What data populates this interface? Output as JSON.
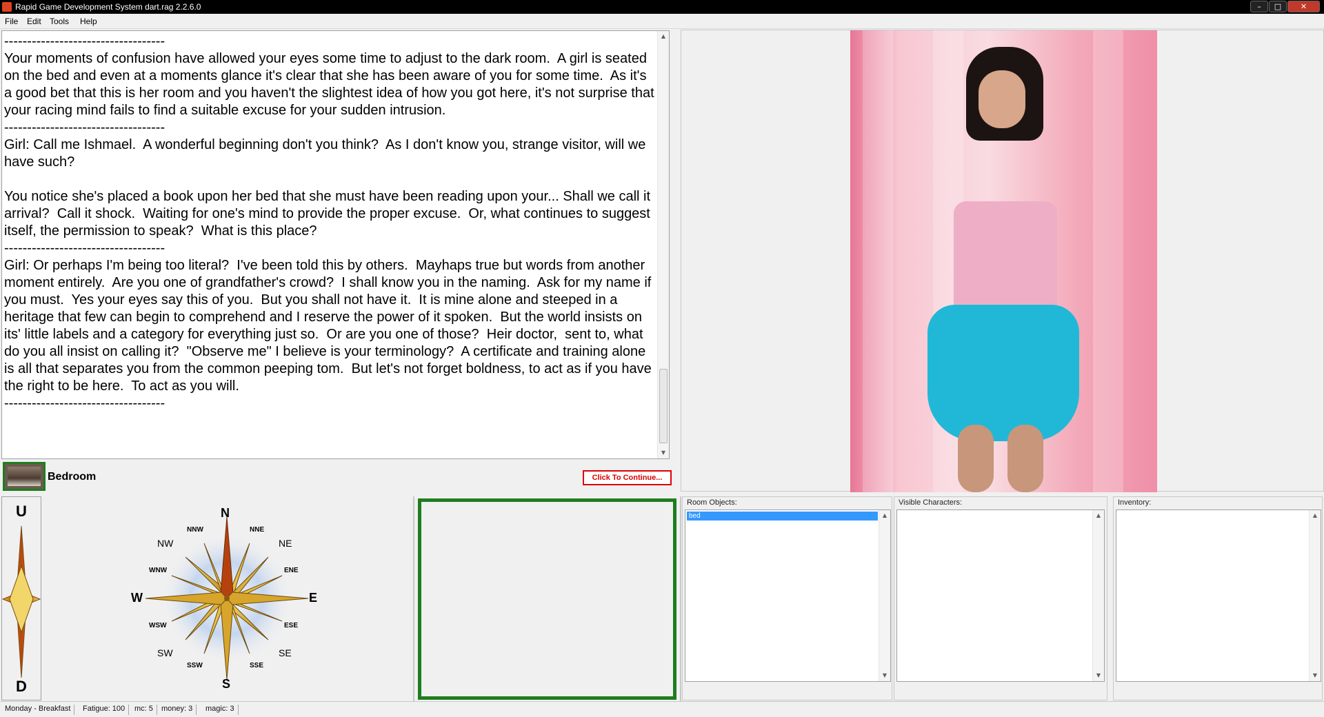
{
  "window": {
    "title": "Rapid Game Development System dart.rag 2.2.6.0",
    "min_label": "–",
    "max_label": "□",
    "close_label": "✕"
  },
  "menu": {
    "file": "File",
    "edit": "Edit",
    "tools": "Tools",
    "help": "Help"
  },
  "story": {
    "text": "-----------------------------------\nYour moments of confusion have allowed your eyes some time to adjust to the dark room.  A girl is seated on the bed and even at a moments glance it's clear that she has been aware of you for some time.  As it's a good bet that this is her room and you haven't the slightest idea of how you got here, it's not surprise that your racing mind fails to find a suitable excuse for your sudden intrusion.\n-----------------------------------\nGirl: Call me Ishmael.  A wonderful beginning don't you think?  As I don't know you, strange visitor, will we have such?\n\nYou notice she's placed a book upon her bed that she must have been reading upon your... Shall we call it arrival?  Call it shock.  Waiting for one's mind to provide the proper excuse.  Or, what continues to suggest itself, the permission to speak?  What is this place?\n-----------------------------------\nGirl: Or perhaps I'm being too literal?  I've been told this by others.  Mayhaps true but words from another moment entirely.  Are you one of grandfather's crowd?  I shall know you in the naming.  Ask for my name if you must.  Yes your eyes say this of you.  But you shall not have it.  It is mine alone and steeped in a heritage that few can begin to comprehend and I reserve the power of it spoken.  But the world insists on its' little labels and a category for everything just so.  Or are you one of those?  Heir doctor,  sent to, what do you all insist on calling it?  \"Observe me\" I believe is your terminology?  A certificate and training alone is all that separates you from the common peeping tom.  But let's not forget boldness, to act as if you have the right to be here.  To act as you will.\n-----------------------------------"
  },
  "location": {
    "room_name": "Bedroom",
    "continue_button": "Click To Continue..."
  },
  "ud": {
    "up": "U",
    "down": "D"
  },
  "compass": {
    "N": "N",
    "S": "S",
    "E": "E",
    "W": "W",
    "NE": "NE",
    "NW": "NW",
    "SE": "SE",
    "SW": "SW",
    "NNE": "NNE",
    "NNW": "NNW",
    "SSE": "SSE",
    "SSW": "SSW",
    "ENE": "ENE",
    "ESE": "ESE",
    "WNW": "WNW",
    "WSW": "WSW"
  },
  "panels": {
    "room_objects_label": "Room Objects:",
    "room_objects": [
      "bed"
    ],
    "visible_characters_label": "Visible Characters:",
    "inventory_label": "Inventory:"
  },
  "status": {
    "day": "Monday - Breakfast",
    "fatigue": "Fatigue: 100",
    "mc": "mc: 5",
    "money": "money: 3",
    "magic": "magic: 3"
  },
  "colors": {
    "accent_green": "#1e7d1e",
    "continue_red": "#dd0000",
    "selection_blue": "#3399ff"
  }
}
